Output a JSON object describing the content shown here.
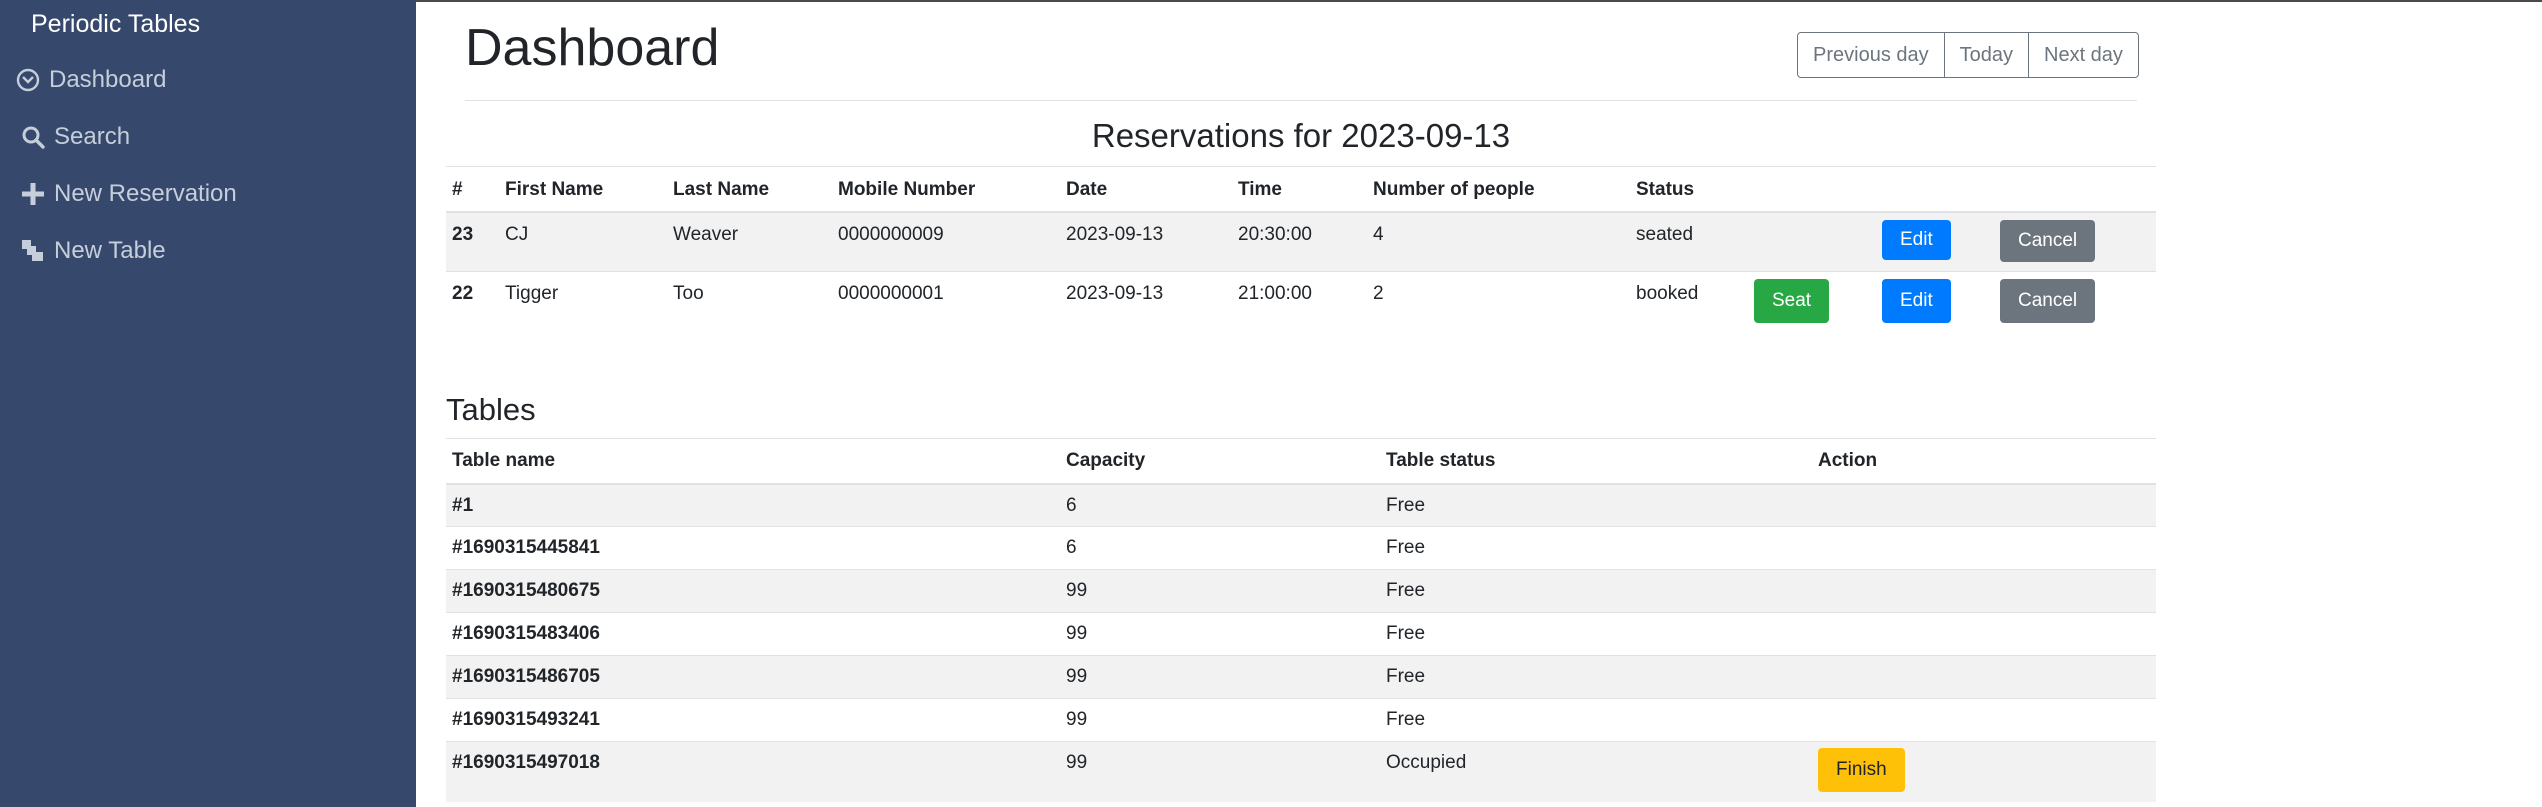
{
  "sidebar": {
    "brand": "Periodic Tables",
    "items": [
      {
        "label": "Dashboard",
        "icon": "dashboard-icon"
      },
      {
        "label": "Search",
        "icon": "search-icon"
      },
      {
        "label": "New Reservation",
        "icon": "plus-icon"
      },
      {
        "label": "New Table",
        "icon": "table-icon"
      }
    ]
  },
  "header": {
    "title": "Dashboard",
    "buttons": {
      "previous": "Previous day",
      "today": "Today",
      "next": "Next day"
    }
  },
  "reservations": {
    "heading": "Reservations for 2023-09-13",
    "columns": [
      "#",
      "First Name",
      "Last Name",
      "Mobile Number",
      "Date",
      "Time",
      "Number of people",
      "Status"
    ],
    "rows": [
      {
        "id": "23",
        "first": "CJ",
        "last": "Weaver",
        "mobile": "0000000009",
        "date": "2023-09-13",
        "time": "20:30:00",
        "people": "4",
        "status": "seated",
        "seat": "",
        "edit": "Edit",
        "cancel": "Cancel"
      },
      {
        "id": "22",
        "first": "Tigger",
        "last": "Too",
        "mobile": "0000000001",
        "date": "2023-09-13",
        "time": "21:00:00",
        "people": "2",
        "status": "booked",
        "seat": "Seat",
        "edit": "Edit",
        "cancel": "Cancel"
      }
    ]
  },
  "tables": {
    "heading": "Tables",
    "columns": [
      "Table name",
      "Capacity",
      "Table status",
      "Action"
    ],
    "rows": [
      {
        "name": "#1",
        "capacity": "6",
        "status": "Free",
        "action": ""
      },
      {
        "name": "#1690315445841",
        "capacity": "6",
        "status": "Free",
        "action": ""
      },
      {
        "name": "#1690315480675",
        "capacity": "99",
        "status": "Free",
        "action": ""
      },
      {
        "name": "#1690315483406",
        "capacity": "99",
        "status": "Free",
        "action": ""
      },
      {
        "name": "#1690315486705",
        "capacity": "99",
        "status": "Free",
        "action": ""
      },
      {
        "name": "#1690315493241",
        "capacity": "99",
        "status": "Free",
        "action": ""
      },
      {
        "name": "#1690315497018",
        "capacity": "99",
        "status": "Occupied",
        "action": "Finish"
      }
    ]
  },
  "colors": {
    "sidebar_bg": "#36496c",
    "seat": "#28a745",
    "edit": "#007bff",
    "cancel": "#6c757d",
    "finish": "#ffc107"
  }
}
